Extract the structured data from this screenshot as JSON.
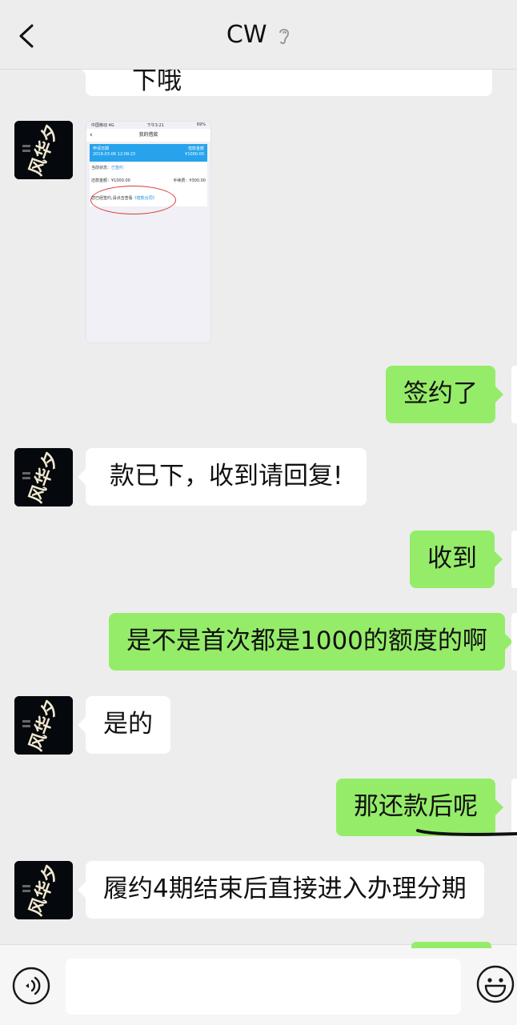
{
  "header": {
    "title": "CW",
    "back_icon": "chevron-left-icon",
    "ear_icon": "ear-icon"
  },
  "partial_top_message": {
    "text": "下哦"
  },
  "shared_screenshot": {
    "status_carrier": "中国移动 4G",
    "status_time": "下午3:21",
    "status_battery": "69%",
    "nav_title": "我的借款",
    "apply_date_label": "申请日期",
    "apply_date": "2019-03-06 12:09:23",
    "amount_label": "借款金额",
    "amount": "¥1000.00",
    "status_label": "当前状态：",
    "status_value": "已签约",
    "repay_label": "还款金额：¥1000.00",
    "fee_label": "手续费：¥300.00",
    "notice_prefix": "您已经签约,请点击查看",
    "notice_link": "《借款合同》"
  },
  "messages": [
    {
      "side": "right",
      "text": "签约了"
    },
    {
      "side": "left",
      "text": "款已下，收到请回复!"
    },
    {
      "side": "right",
      "text": "收到"
    },
    {
      "side": "right",
      "text": "是不是首次都是1000的额度的啊"
    },
    {
      "side": "left",
      "text": "是的"
    },
    {
      "side": "right",
      "text": "那还款后呢"
    },
    {
      "side": "left",
      "text": "履约4期结束后直接进入办理分期"
    }
  ],
  "input_bar": {
    "voice_icon": "voice-icon",
    "emoji_icon": "emoji-icon",
    "placeholder": ""
  },
  "colors": {
    "background": "#ededed",
    "sent_bubble": "#95ec69",
    "received_bubble": "#ffffff"
  }
}
